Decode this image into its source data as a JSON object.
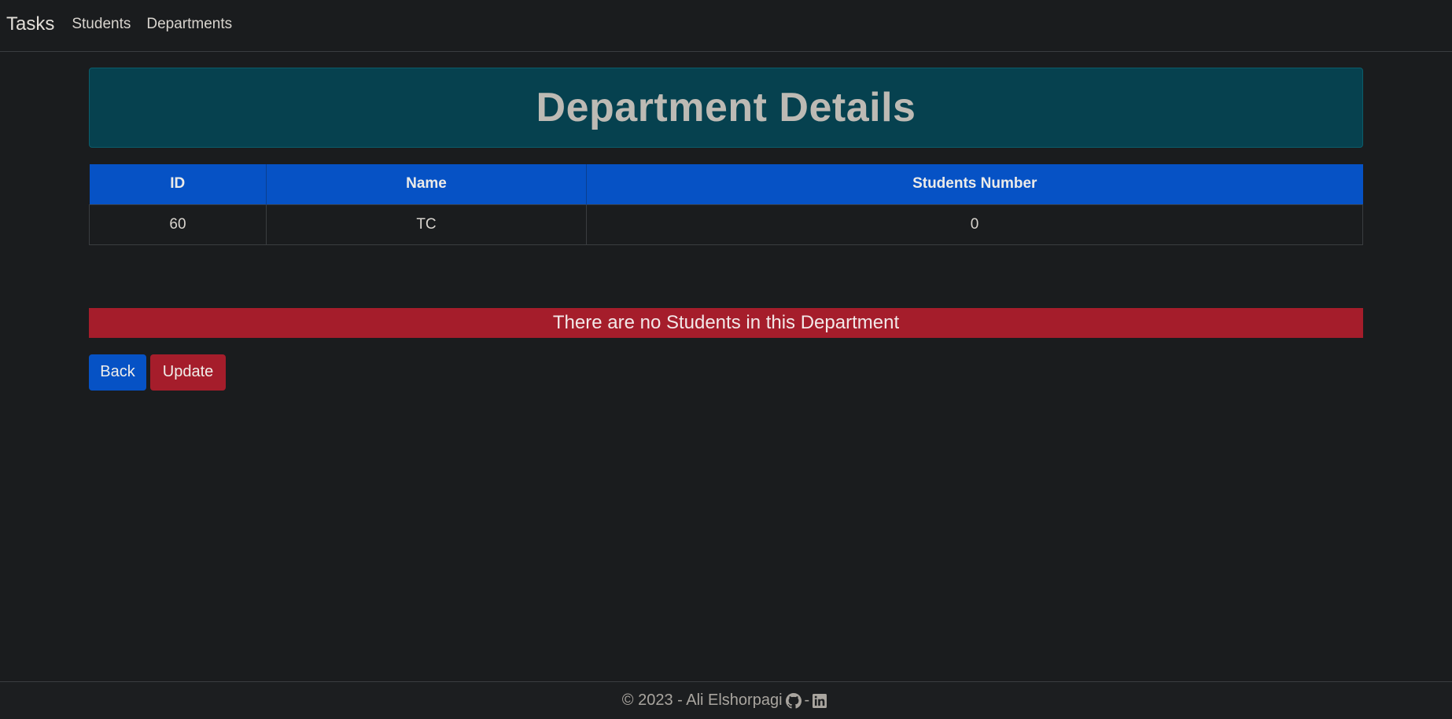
{
  "navbar": {
    "brand": "Tasks",
    "links": [
      "Students",
      "Departments"
    ]
  },
  "header": {
    "title": "Department Details"
  },
  "table": {
    "columns": [
      "ID",
      "Name",
      "Students Number"
    ],
    "rows": [
      [
        "60",
        "TC",
        "0"
      ]
    ]
  },
  "alert": {
    "message": "There are no Students in this Department"
  },
  "actions": {
    "back_label": "Back",
    "update_label": "Update"
  },
  "footer": {
    "text": "© 2023 - Ali Elshorpagi",
    "separator": "-",
    "icons": [
      "github-icon",
      "linkedin-icon"
    ]
  },
  "colors": {
    "primary": "#0652c5",
    "danger": "#a51d2b",
    "header_bg": "#06414f",
    "page_bg": "#1a1c1e"
  }
}
